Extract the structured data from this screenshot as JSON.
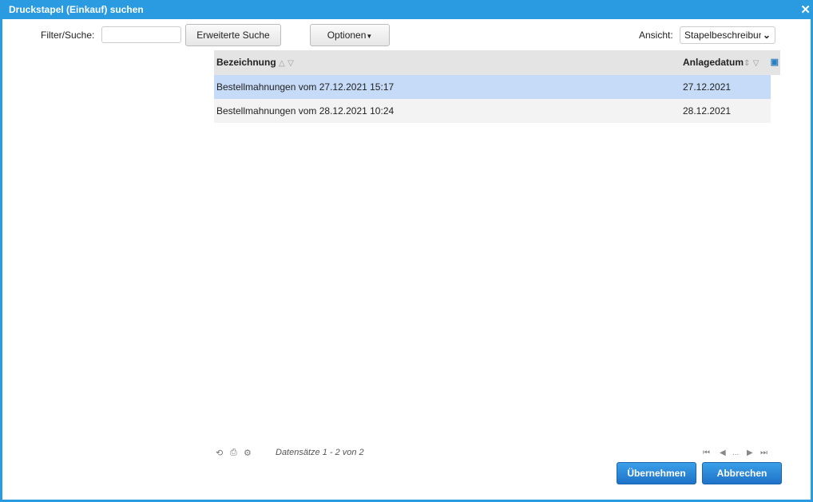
{
  "window": {
    "title": "Druckstapel (Einkauf) suchen"
  },
  "toolbar": {
    "filter_label": "Filter/Suche:",
    "filter_value": "",
    "advanced_search": "Erweiterte Suche",
    "options": "Optionen",
    "view_label": "Ansicht:",
    "view_value": "Stapelbeschreibung"
  },
  "table": {
    "columns": [
      "Bezeichnung",
      "Anlagedatum"
    ],
    "rows": [
      {
        "name": "Bestellmahnungen vom 27.12.2021 15:17",
        "date": "27.12.2021",
        "selected": true
      },
      {
        "name": "Bestellmahnungen vom 28.12.2021 10:24",
        "date": "28.12.2021",
        "selected": false
      }
    ]
  },
  "footer": {
    "records": "Datensätze 1 - 2 von 2",
    "pager_ellipsis": "..."
  },
  "buttons": {
    "apply": "Übernehmen",
    "cancel": "Abbrechen"
  },
  "colors": {
    "accent": "#2a9be0",
    "selected_row": "#c6dbf7"
  }
}
